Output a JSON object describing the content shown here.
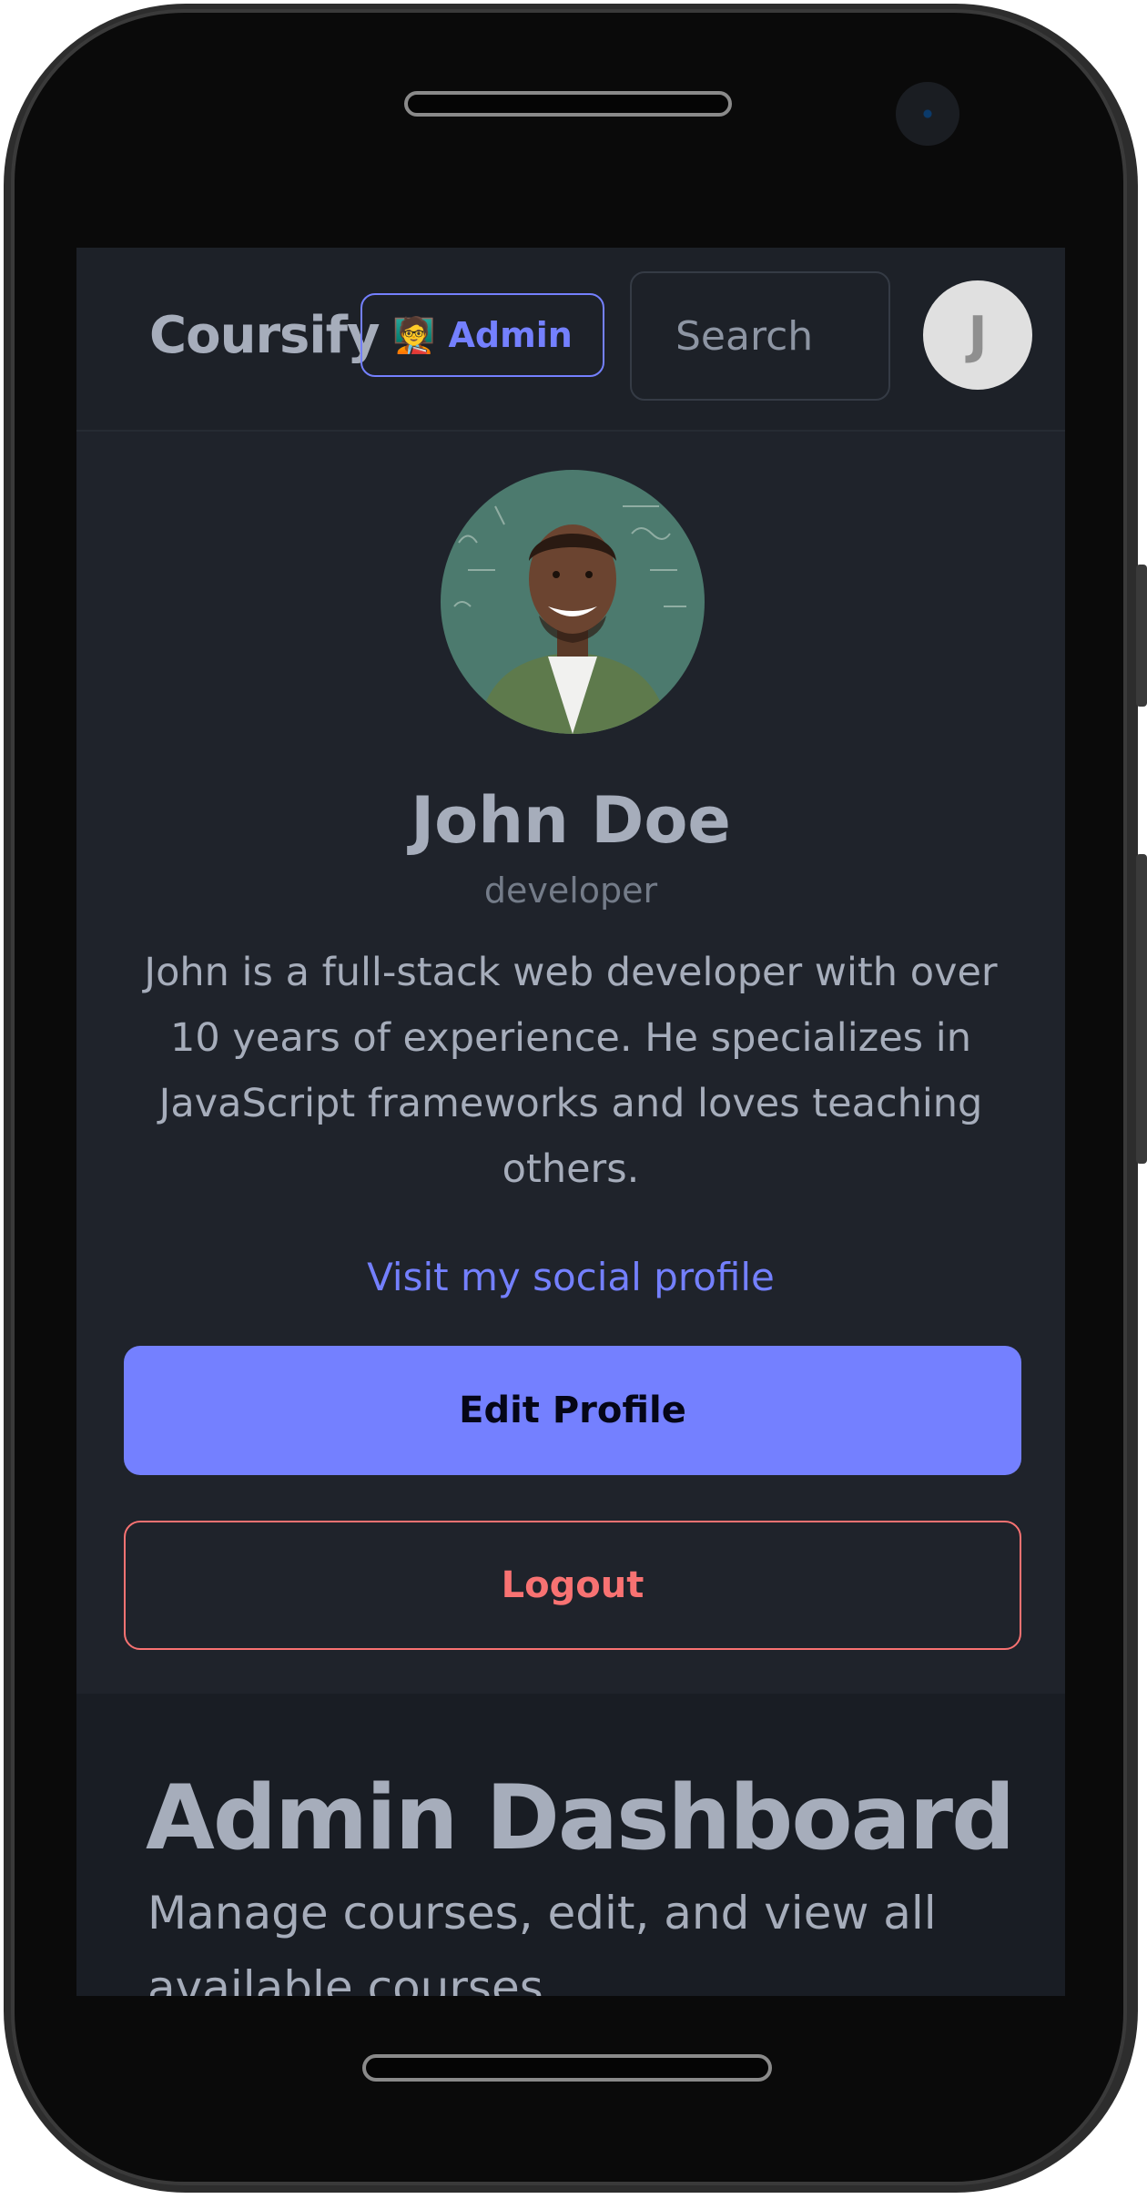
{
  "app": {
    "brand": "Coursify"
  },
  "header": {
    "admin_badge": {
      "emoji": "🧑‍🏫",
      "label": "Admin"
    },
    "search_placeholder": "Search",
    "avatar_initial": "J"
  },
  "profile": {
    "name": "John Doe",
    "role": "developer",
    "bio": "John is a full-stack web developer with over 10 years of experience. He specializes in JavaScript frameworks and loves teaching others.",
    "social_link": "Visit my social profile",
    "edit_button": "Edit Profile",
    "logout_button": "Logout"
  },
  "dashboard": {
    "title": "Admin Dashboard",
    "subtitle": "Manage courses, edit, and view all available courses."
  },
  "colors": {
    "accent": "#7480ff",
    "danger": "#f87272",
    "background": "#1f232b",
    "text": "#a6adbb"
  }
}
